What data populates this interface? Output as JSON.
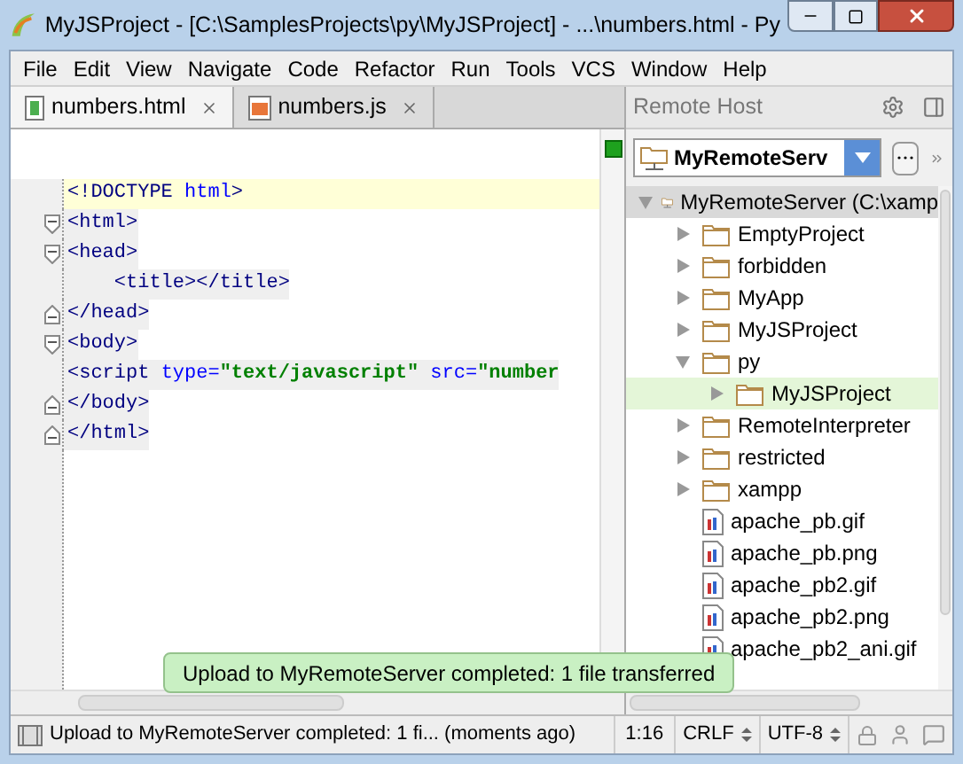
{
  "window": {
    "title": "MyJSProject - [C:\\SamplesProjects\\py\\MyJSProject] - ...\\numbers.html - Py"
  },
  "menu": [
    "File",
    "Edit",
    "View",
    "Navigate",
    "Code",
    "Refactor",
    "Run",
    "Tools",
    "VCS",
    "Window",
    "Help"
  ],
  "editor_tabs": [
    {
      "label": "numbers.html",
      "kind": "html",
      "selected": true
    },
    {
      "label": "numbers.js",
      "kind": "js",
      "selected": false
    }
  ],
  "editor": {
    "lines": [
      {
        "kind": "plain",
        "current": true,
        "tokens": [
          {
            "kind": "tag",
            "text": "<!DOCTYPE "
          },
          {
            "kind": "attr",
            "text": "html"
          },
          {
            "kind": "tag",
            "text": ">"
          }
        ]
      },
      {
        "kind": "fold_start",
        "current": false,
        "tokens": [
          {
            "kind": "tag",
            "text": "<html>"
          }
        ]
      },
      {
        "kind": "fold_start",
        "current": false,
        "tokens": [
          {
            "kind": "tag",
            "text": "<head>"
          }
        ]
      },
      {
        "kind": "plain",
        "current": false,
        "tokens": [
          {
            "kind": "tag",
            "text": "    <title></title>"
          }
        ]
      },
      {
        "kind": "fold_end",
        "current": false,
        "tokens": [
          {
            "kind": "tag",
            "text": "</head>"
          }
        ]
      },
      {
        "kind": "fold_start",
        "current": false,
        "tokens": [
          {
            "kind": "tag",
            "text": "<body>"
          }
        ]
      },
      {
        "kind": "plain",
        "current": false,
        "tokens": [
          {
            "kind": "tag",
            "text": "<script "
          },
          {
            "kind": "attr",
            "text": "type="
          },
          {
            "kind": "value",
            "text": "\"text/javascript\""
          },
          {
            "kind": "attr",
            "text": " src="
          },
          {
            "kind": "value",
            "text": "\"number"
          }
        ]
      },
      {
        "kind": "fold_end",
        "current": false,
        "tokens": [
          {
            "kind": "tag",
            "text": "</body>"
          }
        ]
      },
      {
        "kind": "fold_end",
        "current": false,
        "tokens": [
          {
            "kind": "tag",
            "text": "</html>"
          }
        ]
      }
    ]
  },
  "remote_host": {
    "title": "Remote Host",
    "server": "MyRemoteServ",
    "tree": [
      {
        "label": "MyRemoteServer (C:\\xamp",
        "kind": "server",
        "expanded": true,
        "selected": false,
        "children": [
          {
            "label": "EmptyProject",
            "kind": "folder",
            "expanded": false,
            "selected": false
          },
          {
            "label": "forbidden",
            "kind": "folder",
            "expanded": false,
            "selected": false
          },
          {
            "label": "MyApp",
            "kind": "folder",
            "expanded": false,
            "selected": false
          },
          {
            "label": "MyJSProject",
            "kind": "folder",
            "expanded": false,
            "selected": false
          },
          {
            "label": "py",
            "kind": "folder",
            "expanded": true,
            "selected": false,
            "children": [
              {
                "label": "MyJSProject",
                "kind": "folder",
                "expanded": false,
                "selected": true
              }
            ]
          },
          {
            "label": "RemoteInterpreter",
            "kind": "folder",
            "expanded": false,
            "selected": false
          },
          {
            "label": "restricted",
            "kind": "folder",
            "expanded": false,
            "selected": false
          },
          {
            "label": "xampp",
            "kind": "folder",
            "expanded": false,
            "selected": false
          },
          {
            "label": "apache_pb.gif",
            "kind": "file",
            "expanded": false,
            "selected": false
          },
          {
            "label": "apache_pb.png",
            "kind": "file",
            "expanded": false,
            "selected": false
          },
          {
            "label": "apache_pb2.gif",
            "kind": "file",
            "expanded": false,
            "selected": false
          },
          {
            "label": "apache_pb2.png",
            "kind": "file",
            "expanded": false,
            "selected": false
          },
          {
            "label": "apache_pb2_ani.gif",
            "kind": "file",
            "expanded": false,
            "selected": false
          }
        ]
      }
    ]
  },
  "tooltip": "Upload to MyRemoteServer completed: 1 file transferred",
  "status_bar": {
    "message": "Upload to MyRemoteServer completed: 1 fi... (moments ago)",
    "position": "1:16",
    "line_separator": "CRLF",
    "encoding": "UTF-8"
  }
}
